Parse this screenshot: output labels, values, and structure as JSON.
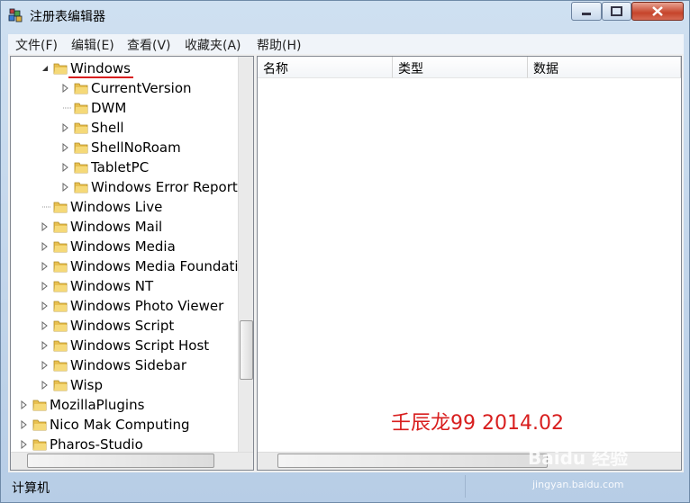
{
  "window": {
    "title": "注册表编辑器"
  },
  "menu": [
    "文件(F)",
    "编辑(E)",
    "查看(V)",
    "收藏夹(A)",
    "帮助(H)"
  ],
  "tree": {
    "selected": "Windows",
    "nodes": [
      {
        "label": "Windows",
        "level": 1,
        "expander": "expanded"
      },
      {
        "label": "CurrentVersion",
        "level": 2,
        "expander": "collapsed"
      },
      {
        "label": "DWM",
        "level": 2,
        "expander": "none"
      },
      {
        "label": "Shell",
        "level": 2,
        "expander": "collapsed"
      },
      {
        "label": "ShellNoRoam",
        "level": 2,
        "expander": "collapsed"
      },
      {
        "label": "TabletPC",
        "level": 2,
        "expander": "collapsed"
      },
      {
        "label": "Windows Error Reporti",
        "level": 2,
        "expander": "collapsed"
      },
      {
        "label": "Windows Live",
        "level": 1,
        "expander": "none"
      },
      {
        "label": "Windows Mail",
        "level": 1,
        "expander": "collapsed"
      },
      {
        "label": "Windows Media",
        "level": 1,
        "expander": "collapsed"
      },
      {
        "label": "Windows Media Foundatic",
        "level": 1,
        "expander": "collapsed"
      },
      {
        "label": "Windows NT",
        "level": 1,
        "expander": "collapsed"
      },
      {
        "label": "Windows Photo Viewer",
        "level": 1,
        "expander": "collapsed"
      },
      {
        "label": "Windows Script",
        "level": 1,
        "expander": "collapsed"
      },
      {
        "label": "Windows Script Host",
        "level": 1,
        "expander": "collapsed"
      },
      {
        "label": "Windows Sidebar",
        "level": 1,
        "expander": "collapsed"
      },
      {
        "label": "Wisp",
        "level": 1,
        "expander": "collapsed"
      },
      {
        "label": "MozillaPlugins",
        "level": 0,
        "expander": "collapsed"
      },
      {
        "label": "Nico Mak Computing",
        "level": 0,
        "expander": "collapsed"
      },
      {
        "label": "Pharos-Studio",
        "level": 0,
        "expander": "collapsed"
      }
    ]
  },
  "columns": [
    "名称",
    "类型",
    "数据"
  ],
  "status": "计算机",
  "overlay_text": "壬辰龙99 2014.02",
  "watermark": {
    "logo": "Baidu 经验",
    "url": "jingyan.baidu.com"
  },
  "colors": {
    "accent_red": "#d81e1e",
    "folder": "#e8c050"
  }
}
